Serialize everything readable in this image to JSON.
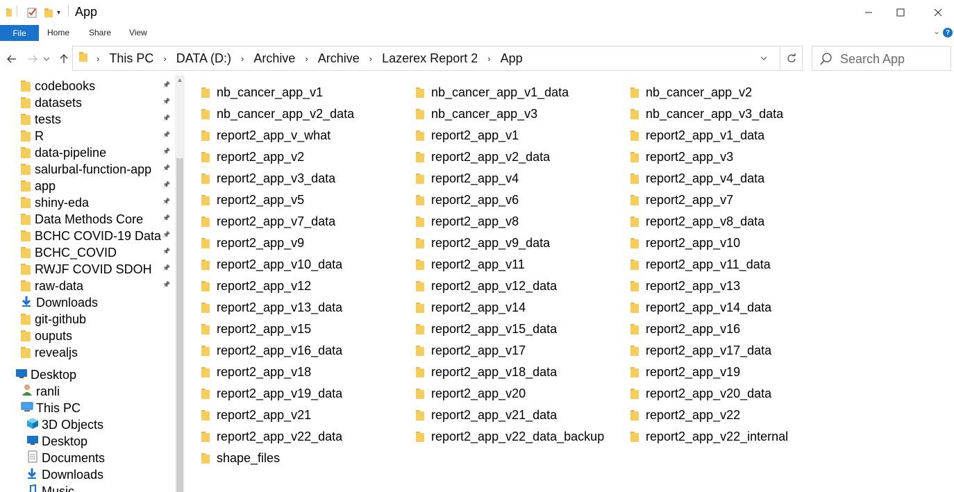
{
  "window": {
    "title": "App"
  },
  "ribbon": {
    "file": "File",
    "home": "Home",
    "share": "Share",
    "view": "View",
    "help": "?"
  },
  "address": {
    "crumbs": [
      "This PC",
      "DATA (D:)",
      "Archive",
      "Archive",
      "Lazerex Report 2",
      "App"
    ]
  },
  "search": {
    "placeholder": "Search App"
  },
  "nav": {
    "quick_access": [
      {
        "label": "codebooks",
        "pinned": true
      },
      {
        "label": "datasets",
        "pinned": true
      },
      {
        "label": "tests",
        "pinned": true
      },
      {
        "label": "R",
        "pinned": true
      },
      {
        "label": "data-pipeline",
        "pinned": true
      },
      {
        "label": "salurbal-function-app",
        "pinned": true
      },
      {
        "label": "app",
        "pinned": true
      },
      {
        "label": "shiny-eda",
        "pinned": true
      },
      {
        "label": "Data Methods Core",
        "pinned": true
      },
      {
        "label": "BCHC COVID-19 Data",
        "pinned": true
      },
      {
        "label": "BCHC_COVID",
        "pinned": true
      },
      {
        "label": "RWJF COVID SDOH",
        "pinned": true
      },
      {
        "label": "raw-data",
        "pinned": true
      },
      {
        "label": "Downloads",
        "pinned": false,
        "icon": "download-icon"
      },
      {
        "label": "git-github",
        "pinned": false
      },
      {
        "label": "ouputs",
        "pinned": false
      },
      {
        "label": "revealjs",
        "pinned": false
      }
    ],
    "desktop": "Desktop",
    "user": "ranli",
    "this_pc": "This PC",
    "pc_children": [
      "3D Objects",
      "Desktop",
      "Documents",
      "Downloads",
      "Music"
    ]
  },
  "files": [
    "nb_cancer_app_v1",
    "nb_cancer_app_v1_data",
    "nb_cancer_app_v2",
    "nb_cancer_app_v2_data",
    "nb_cancer_app_v3",
    "nb_cancer_app_v3_data",
    "report2_app_v_what",
    "report2_app_v1",
    "report2_app_v1_data",
    "report2_app_v2",
    "report2_app_v2_data",
    "report2_app_v3",
    "report2_app_v3_data",
    "report2_app_v4",
    "report2_app_v4_data",
    "report2_app_v5",
    "report2_app_v6",
    "report2_app_v7",
    "report2_app_v7_data",
    "report2_app_v8",
    "report2_app_v8_data",
    "report2_app_v9",
    "report2_app_v9_data",
    "report2_app_v10",
    "report2_app_v10_data",
    "report2_app_v11",
    "report2_app_v11_data",
    "report2_app_v12",
    "report2_app_v12_data",
    "report2_app_v13",
    "report2_app_v13_data",
    "report2_app_v14",
    "report2_app_v14_data",
    "report2_app_v15",
    "report2_app_v15_data",
    "report2_app_v16",
    "report2_app_v16_data",
    "report2_app_v17",
    "report2_app_v17_data",
    "report2_app_v18",
    "report2_app_v18_data",
    "report2_app_v19",
    "report2_app_v19_data",
    "report2_app_v20",
    "report2_app_v20_data",
    "report2_app_v21",
    "report2_app_v21_data",
    "report2_app_v22",
    "report2_app_v22_data",
    "report2_app_v22_data_backup",
    "report2_app_v22_internal",
    "shape_files"
  ]
}
